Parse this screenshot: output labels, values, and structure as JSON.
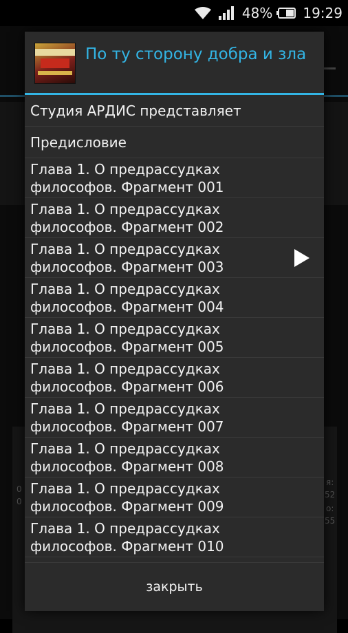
{
  "status_bar": {
    "battery_percent": "48%",
    "time": "19:29"
  },
  "background": {
    "left_numbers": [
      "0",
      "0"
    ],
    "right_numbers": [
      "я:",
      "52",
      "о:",
      "55"
    ]
  },
  "dialog": {
    "title": "По ту сторону добра и зла",
    "close_label": "закрыть",
    "playing_index": 4,
    "items": [
      "Студия АРДИС представляет",
      "Предисловие",
      "Глава 1. О предрассудках философов. Фрагмент 001",
      "Глава 1. О предрассудках философов. Фрагмент 002",
      "Глава 1. О предрассудках философов. Фрагмент 003",
      "Глава 1. О предрассудках философов. Фрагмент 004",
      "Глава 1. О предрассудках философов. Фрагмент 005",
      "Глава 1. О предрассудках философов. Фрагмент 006",
      "Глава 1. О предрассудках философов. Фрагмент 007",
      "Глава 1. О предрассудках философов. Фрагмент 008",
      "Глава 1. О предрассудках философов. Фрагмент 009",
      "Глава 1. О предрассудках философов. Фрагмент 010"
    ]
  }
}
